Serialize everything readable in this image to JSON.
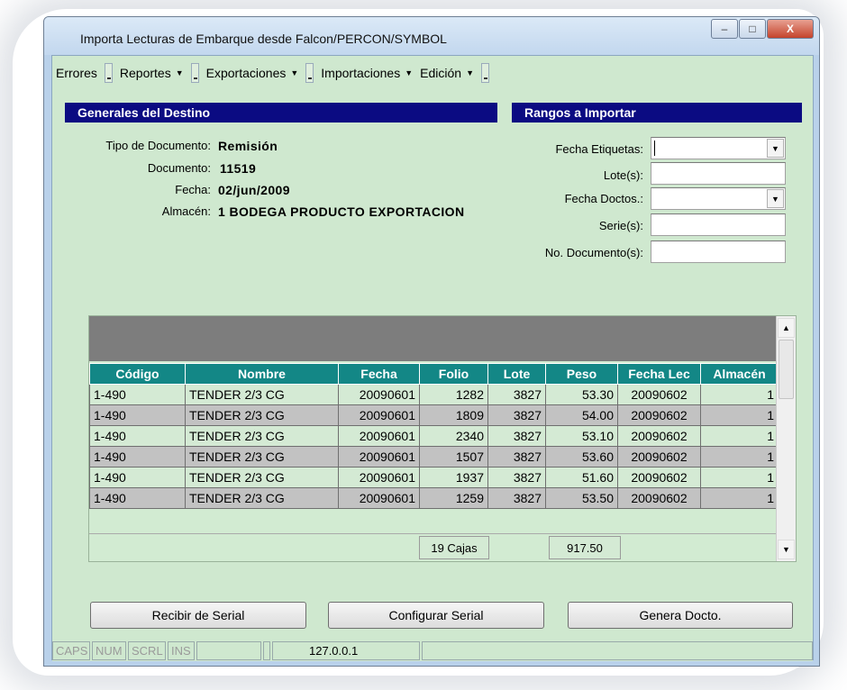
{
  "window": {
    "title": "Importa Lecturas de Embarque desde Falcon/PERCON/SYMBOL",
    "minimize": "–",
    "maximize": "□",
    "close": "X"
  },
  "menu": [
    {
      "label": "Errores",
      "has_arrow": false
    },
    {
      "label": "Reportes",
      "has_arrow": true
    },
    {
      "label": "Exportaciones",
      "has_arrow": true
    },
    {
      "label": "Importaciones",
      "has_arrow": true
    },
    {
      "label": "Edición",
      "has_arrow": true
    }
  ],
  "destino": {
    "header": "Generales del Destino",
    "tipo_label": "Tipo de Documento:",
    "tipo_value": "Remisión",
    "documento_label": "Documento:",
    "documento_value": "11519",
    "fecha_label": "Fecha:",
    "fecha_value": "02/jun/2009",
    "almacen_label": "Almacén:",
    "almacen_value": "1 BODEGA PRODUCTO EXPORTACION"
  },
  "rangos": {
    "header": "Rangos a Importar",
    "fecha_etiquetas_label": "Fecha Etiquetas:",
    "fecha_etiquetas_value": "",
    "lotes_label": "Lote(s):",
    "lotes_value": "",
    "fecha_doctos_label": "Fecha Doctos.:",
    "fecha_doctos_value": "",
    "series_label": "Serie(s):",
    "series_value": "",
    "no_documentos_label": "No. Documento(s):",
    "no_documentos_value": ""
  },
  "grid": {
    "columns": [
      "Código",
      "Nombre",
      "Fecha",
      "Folio",
      "Lote",
      "Peso",
      "Fecha Lec",
      "Almacén"
    ],
    "rows": [
      [
        "1-490",
        "TENDER 2/3 CG",
        "20090601",
        "1282",
        "3827",
        "53.30",
        "20090602",
        "1"
      ],
      [
        "1-490",
        "TENDER 2/3 CG",
        "20090601",
        "1809",
        "3827",
        "54.00",
        "20090602",
        "1"
      ],
      [
        "1-490",
        "TENDER 2/3 CG",
        "20090601",
        "2340",
        "3827",
        "53.10",
        "20090602",
        "1"
      ],
      [
        "1-490",
        "TENDER 2/3 CG",
        "20090601",
        "1507",
        "3827",
        "53.60",
        "20090602",
        "1"
      ],
      [
        "1-490",
        "TENDER 2/3 CG",
        "20090601",
        "1937",
        "3827",
        "51.60",
        "20090602",
        "1"
      ],
      [
        "1-490",
        "TENDER 2/3 CG",
        "20090601",
        "1259",
        "3827",
        "53.50",
        "20090602",
        "1"
      ]
    ],
    "total_cajas": "19 Cajas",
    "total_peso": "917.50"
  },
  "buttons": {
    "recibir": "Recibir de Serial",
    "configurar": "Configurar Serial",
    "genera": "Genera Docto."
  },
  "statusbar": {
    "caps": "CAPS",
    "num": "NUM",
    "scrl": "SCRL",
    "ins": "INS",
    "ip": "127.0.0.1"
  },
  "colors": {
    "section_header": "#0b0b82",
    "grid_header": "#138786",
    "form_background": "#cfe8cf"
  }
}
